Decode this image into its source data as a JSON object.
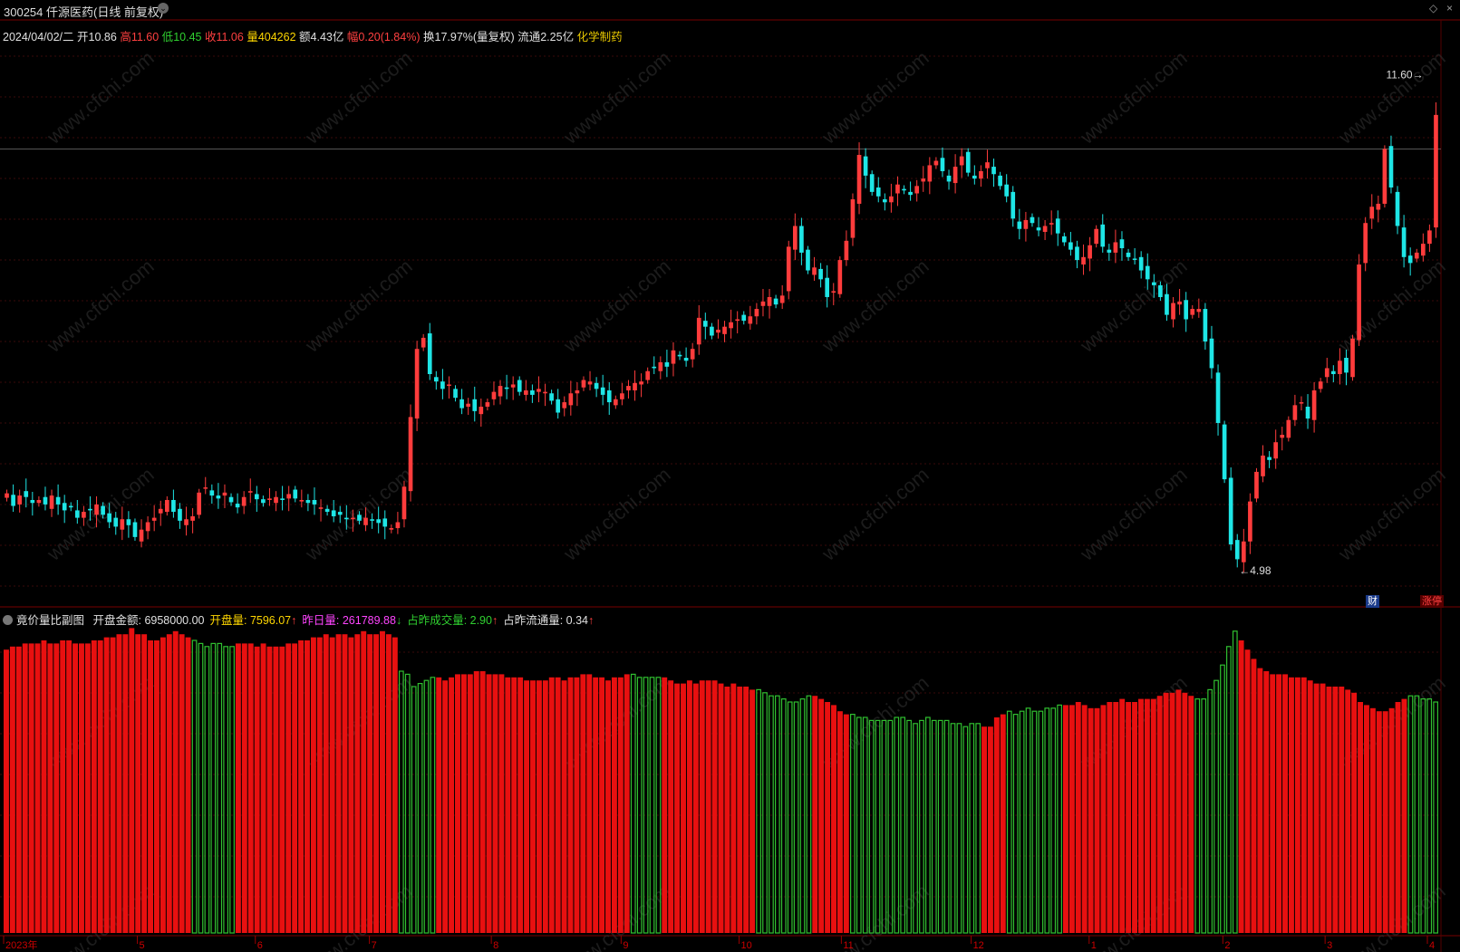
{
  "header": {
    "title": "300254 仟源医药(日线 前复权)",
    "window_controls": [
      "◇",
      "×"
    ]
  },
  "quote": {
    "date": "2024/04/02/二",
    "open_label": "开",
    "open": "10.86",
    "high_label": "高",
    "high": "11.60",
    "low_label": "低",
    "low": "10.45",
    "close_label": "收",
    "close": "11.06",
    "vol_label": "量",
    "vol": "404262",
    "amount_label": "额",
    "amount": "4.43亿",
    "change_label": "幅",
    "change": "0.20(1.84%)",
    "turnover_label": "换",
    "turnover": "17.97%(量复权)",
    "float_label": "流通",
    "float": "2.25亿",
    "sector": "化学制药"
  },
  "indicator": {
    "name": "竟价量比副图",
    "items": [
      {
        "label": "开盘金额: ",
        "value": "6958000.00",
        "arrow": "",
        "color": "#e0e0e0"
      },
      {
        "label": "开盘量: ",
        "value": "7596.07",
        "arrow": "↑",
        "color": "#ffd700"
      },
      {
        "label": "昨日量: ",
        "value": "261789.88",
        "arrow": "↓",
        "color": "#ff44ff"
      },
      {
        "label": "占昨成交量: ",
        "value": "2.90",
        "arrow": "↑",
        "color": "#30d030"
      },
      {
        "label": "占昨流通量: ",
        "value": "0.34",
        "arrow": "↑",
        "color": "#e0e0e0"
      }
    ]
  },
  "badges": {
    "fin": "财",
    "limit_up": "涨停"
  },
  "watermark": "www.cfchi.com",
  "colors": {
    "up": "#ff3c3c",
    "down": "#1ee6e6",
    "bar_up": "#e81010",
    "bar_down": "#30c030"
  },
  "chart_data": [
    {
      "type": "candlestick",
      "title": "300254 仟源医药(日线 前复权)",
      "ylim": [
        4.6,
        12.0
      ],
      "price_markers": {
        "high": "11.60",
        "low": "4.98"
      },
      "x_ticks": [
        "2023年",
        "5",
        "6",
        "7",
        "8",
        "9",
        "10",
        "11",
        "12",
        "1",
        "2",
        "3",
        "4"
      ],
      "grid": true,
      "ohlc_close": [
        5.95,
        5.78,
        5.92,
        5.9,
        5.82,
        5.86,
        5.8,
        5.92,
        5.8,
        5.72,
        5.76,
        5.62,
        5.7,
        5.72,
        5.8,
        5.66,
        5.56,
        5.5,
        5.6,
        5.52,
        5.36,
        5.46,
        5.56,
        5.62,
        5.74,
        5.86,
        5.7,
        5.58,
        5.6,
        5.64,
        5.96,
        6.03,
        5.92,
        5.88,
        5.96,
        5.83,
        5.76,
        5.9,
        5.98,
        5.87,
        5.82,
        5.88,
        5.9,
        5.86,
        5.94,
        5.88,
        5.86,
        5.82,
        5.8,
        5.76,
        5.7,
        5.64,
        5.66,
        5.6,
        5.62,
        5.58,
        5.62,
        5.58,
        5.55,
        5.5,
        5.48,
        5.56,
        6.04,
        6.98,
        7.9,
        8.05,
        7.56,
        7.46,
        7.36,
        7.42,
        7.24,
        7.1,
        7.16,
        7.06,
        7.12,
        7.18,
        7.32,
        7.4,
        7.36,
        7.42,
        7.32,
        7.34,
        7.28,
        7.36,
        7.32,
        7.2,
        7.04,
        7.18,
        7.3,
        7.34,
        7.48,
        7.46,
        7.36,
        7.28,
        7.18,
        7.22,
        7.3,
        7.4,
        7.44,
        7.46,
        7.6,
        7.64,
        7.72,
        7.66,
        7.88,
        7.8,
        7.74,
        7.9,
        8.32,
        8.2,
        8.08,
        8.16,
        8.2,
        8.26,
        8.3,
        8.28,
        8.34,
        8.44,
        8.54,
        8.6,
        8.5,
        8.62,
        9.28,
        9.56,
        9.2,
        8.96,
        9.0,
        8.84,
        8.6,
        8.68,
        9.1,
        9.36,
        9.92,
        10.52,
        10.24,
        10.02,
        9.96,
        9.88,
        9.96,
        10.12,
        10.04,
        9.98,
        10.1,
        10.2,
        10.38,
        10.44,
        10.3,
        10.16,
        10.36,
        10.5,
        10.28,
        10.2,
        10.3,
        10.42,
        10.26,
        10.1,
        9.96,
        9.66,
        9.52,
        9.64,
        9.6,
        9.5,
        9.56,
        9.6,
        9.46,
        9.34,
        9.24,
        9.1,
        9.14,
        9.3,
        9.52,
        9.28,
        9.2,
        9.34,
        9.26,
        9.14,
        9.12,
        8.96,
        8.84,
        8.76,
        8.6,
        8.36,
        8.52,
        8.54,
        8.3,
        8.44,
        8.44,
        8.0,
        7.64,
        6.9,
        6.14,
        5.26,
        5.06,
        5.3,
        5.84,
        6.24,
        6.46,
        6.4,
        6.64,
        6.74,
        6.94,
        7.14,
        7.18,
        6.96,
        7.34,
        7.46,
        7.64,
        7.56,
        7.74,
        7.58,
        8.04,
        9.04,
        9.6,
        9.82,
        9.86,
        10.6,
        10.08,
        9.56,
        9.14,
        9.06,
        9.2,
        9.32,
        9.5,
        11.06
      ]
    },
    {
      "type": "bar",
      "title": "竟价量比副图",
      "ylim": [
        0,
        1.0
      ],
      "values": [
        0.92,
        0.93,
        0.93,
        0.94,
        0.94,
        0.94,
        0.95,
        0.94,
        0.94,
        0.95,
        0.95,
        0.94,
        0.94,
        0.94,
        0.95,
        0.95,
        0.96,
        0.96,
        0.97,
        0.97,
        0.99,
        0.97,
        0.97,
        0.95,
        0.95,
        0.96,
        0.97,
        0.98,
        0.97,
        0.96,
        0.95,
        0.94,
        0.93,
        0.94,
        0.94,
        0.93,
        0.93,
        0.94,
        0.94,
        0.94,
        0.93,
        0.94,
        0.93,
        0.93,
        0.93,
        0.94,
        0.94,
        0.95,
        0.95,
        0.96,
        0.96,
        0.97,
        0.96,
        0.97,
        0.97,
        0.96,
        0.97,
        0.98,
        0.97,
        0.97,
        0.98,
        0.97,
        0.96,
        0.85,
        0.84,
        0.8,
        0.81,
        0.82,
        0.83,
        0.83,
        0.82,
        0.83,
        0.84,
        0.84,
        0.84,
        0.85,
        0.85,
        0.84,
        0.84,
        0.84,
        0.83,
        0.83,
        0.83,
        0.82,
        0.82,
        0.82,
        0.82,
        0.83,
        0.83,
        0.82,
        0.83,
        0.83,
        0.84,
        0.84,
        0.83,
        0.83,
        0.82,
        0.83,
        0.83,
        0.84,
        0.84,
        0.83,
        0.83,
        0.83,
        0.83,
        0.83,
        0.82,
        0.81,
        0.81,
        0.82,
        0.81,
        0.82,
        0.82,
        0.82,
        0.81,
        0.8,
        0.81,
        0.8,
        0.8,
        0.79,
        0.79,
        0.78,
        0.77,
        0.77,
        0.76,
        0.75,
        0.75,
        0.76,
        0.77,
        0.77,
        0.76,
        0.75,
        0.74,
        0.72,
        0.71,
        0.71,
        0.7,
        0.7,
        0.69,
        0.69,
        0.69,
        0.69,
        0.7,
        0.7,
        0.69,
        0.68,
        0.69,
        0.7,
        0.69,
        0.69,
        0.69,
        0.68,
        0.68,
        0.67,
        0.68,
        0.68,
        0.67,
        0.67,
        0.7,
        0.71,
        0.72,
        0.71,
        0.72,
        0.73,
        0.72,
        0.72,
        0.73,
        0.73,
        0.74,
        0.74,
        0.74,
        0.75,
        0.74,
        0.73,
        0.73,
        0.74,
        0.75,
        0.75,
        0.76,
        0.75,
        0.75,
        0.76,
        0.76,
        0.76,
        0.77,
        0.78,
        0.78,
        0.79,
        0.78,
        0.77,
        0.76,
        0.76,
        0.79,
        0.82,
        0.87,
        0.93,
        0.98,
        0.95,
        0.92,
        0.89,
        0.86,
        0.85,
        0.84,
        0.84,
        0.84,
        0.83,
        0.83,
        0.83,
        0.82,
        0.81,
        0.81,
        0.8,
        0.8,
        0.8,
        0.79,
        0.78,
        0.75,
        0.74,
        0.73,
        0.72,
        0.72,
        0.73,
        0.75,
        0.76,
        0.77,
        0.77,
        0.76,
        0.76,
        0.75
      ],
      "colors_per_bar": "red when open ratio rises, green outline when falls",
      "grid": true
    }
  ]
}
